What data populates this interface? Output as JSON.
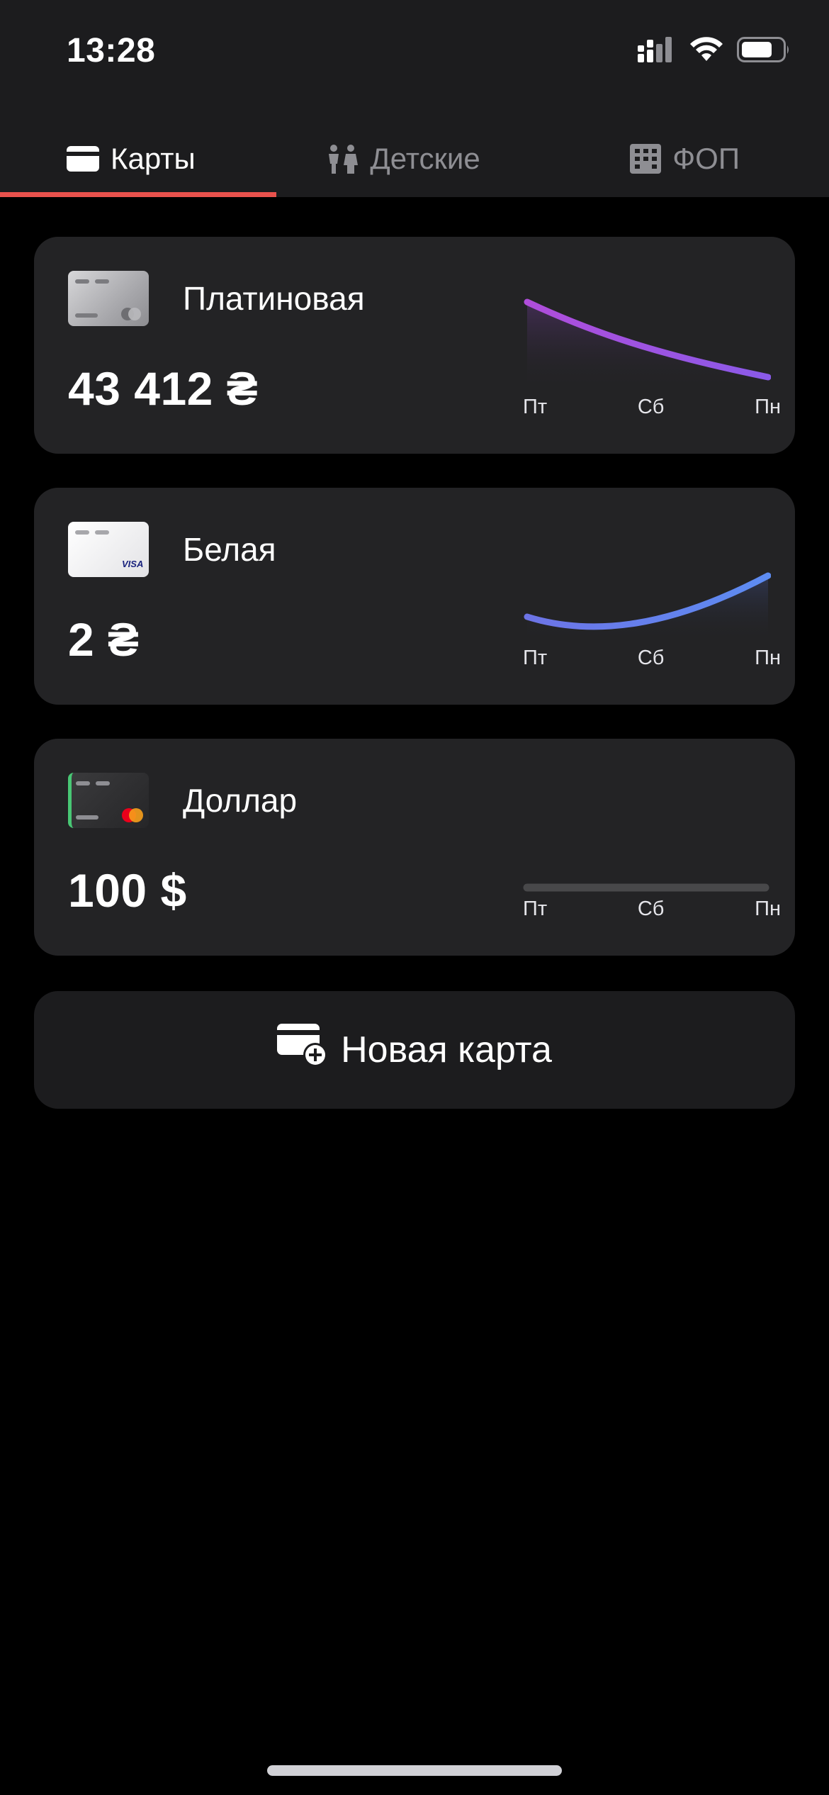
{
  "status": {
    "time": "13:28",
    "icons": [
      "cellular-signal-icon",
      "wifi-icon",
      "battery-icon"
    ]
  },
  "tabs": [
    {
      "label": "Карты",
      "icon": "credit-card-icon",
      "active": true
    },
    {
      "label": "Детские",
      "icon": "children-icon",
      "active": false
    },
    {
      "label": "ФОП",
      "icon": "building-icon",
      "active": false
    }
  ],
  "cards": [
    {
      "name": "Платиновая",
      "balance": "43 412 ₴",
      "thumb": "platinum",
      "days": [
        "Пт",
        "Сб",
        "Пн"
      ]
    },
    {
      "name": "Белая",
      "balance": "2 ₴",
      "thumb": "white",
      "thumb_brand": "VISA",
      "days": [
        "Пт",
        "Сб",
        "Пн"
      ]
    },
    {
      "name": "Доллар",
      "balance": "100 $",
      "thumb": "dollar",
      "days": [
        "Пт",
        "Сб",
        "Пн"
      ]
    }
  ],
  "new_card": {
    "label": "Новая карта",
    "icon": "add-card-icon"
  },
  "colors": {
    "accent": "#e9524d",
    "background": "#000000",
    "surface": "#232325",
    "purple": "#b04ddb",
    "blue": "#6d7cf3"
  }
}
